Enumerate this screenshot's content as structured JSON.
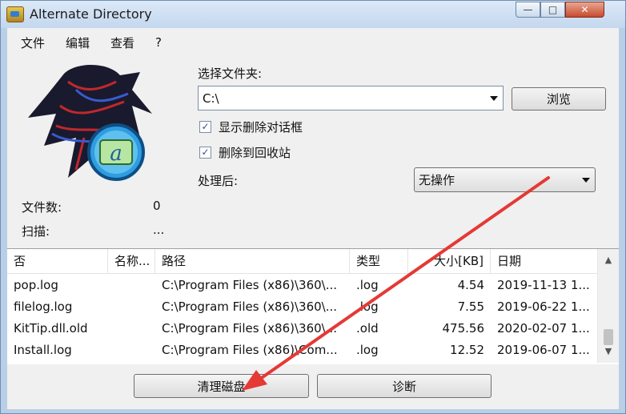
{
  "window": {
    "title": "Alternate Directory"
  },
  "window_controls": {
    "minimize": "—",
    "maximize": "□",
    "close": "✕"
  },
  "menu": [
    "文件",
    "编辑",
    "查看",
    "?"
  ],
  "stats": {
    "files_label": "文件数:",
    "files_value": "0",
    "scan_label": "扫描:",
    "scan_value": "..."
  },
  "folder": {
    "label": "选择文件夹:",
    "value": "C:\\",
    "browse_label": "浏览"
  },
  "options": [
    {
      "label": "显示删除对话框",
      "checked": true
    },
    {
      "label": "删除到回收站",
      "checked": true
    }
  ],
  "after": {
    "label": "处理后:",
    "value": "无操作"
  },
  "table": {
    "columns": [
      "否",
      "名称...",
      "路径",
      "类型",
      "大小[KB]",
      "日期"
    ],
    "rows": [
      [
        "pop.log",
        "",
        "C:\\Program Files (x86)\\360\\...",
        ".log",
        "4.54",
        "2019-11-13 1..."
      ],
      [
        "filelog.log",
        "",
        "C:\\Program Files (x86)\\360\\...",
        ".log",
        "7.55",
        "2019-06-22 1..."
      ],
      [
        "KitTip.dll.old",
        "",
        "C:\\Program Files (x86)\\360\\...",
        ".old",
        "475.56",
        "2020-02-07 1..."
      ],
      [
        "Install.log",
        "",
        "C:\\Program Files (x86)\\Com...",
        ".log",
        "12.52",
        "2019-06-07 1..."
      ]
    ]
  },
  "actions": {
    "clean_label": "清理磁盘",
    "diagnose_label": "诊断"
  },
  "colors": {
    "annotation_arrow": "#e53935",
    "title_bar": "#c3d7ee"
  },
  "icons": [
    "app-icon",
    "logo-image",
    "dropdown-arrow-icon",
    "checkbox-icon",
    "scroll-up-icon",
    "scroll-down-icon"
  ]
}
